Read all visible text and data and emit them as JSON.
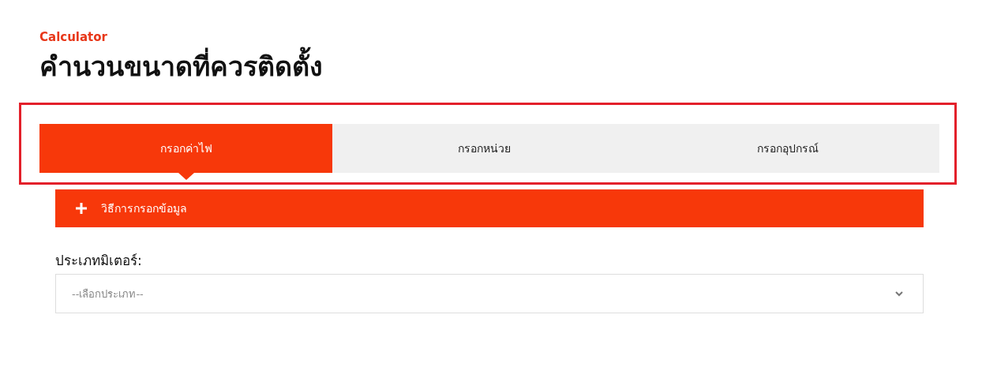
{
  "header": {
    "eyebrow": "Calculator",
    "title": "คำนวนขนาดที่ควรติดตั้ง"
  },
  "tabs": [
    {
      "label": "กรอกค่าไฟ",
      "selected": true
    },
    {
      "label": "กรอกหน่วย",
      "selected": false
    },
    {
      "label": "กรอกอุปกรณ์",
      "selected": false
    }
  ],
  "accordion": {
    "label": "วิธีการกรอกข้อมูล",
    "expanded": false
  },
  "meter_type": {
    "label": "ประเภทมิเตอร์:",
    "placeholder": "--เลือกประเภท--"
  }
}
